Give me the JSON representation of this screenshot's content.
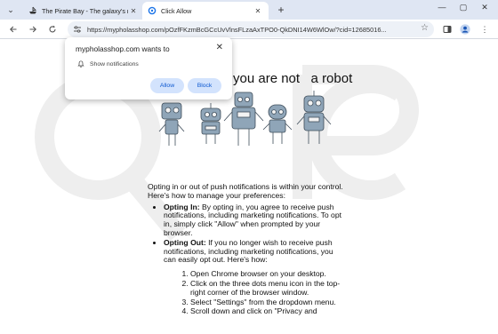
{
  "tabs": [
    {
      "title": "The Pirate Bay - The galaxy's m",
      "active": false
    },
    {
      "title": "Click Allow",
      "active": true
    }
  ],
  "toolbar": {
    "url": "https://mypholasshop.com/pOzfFKzmBcGCcUvVlnsFLzaAxTPO0-QkDNI14W6WlOw/?cid=12685016..."
  },
  "popup": {
    "title": "mypholasshop.com wants to",
    "permission": "Show notifications",
    "allow_label": "Allow",
    "block_label": "Block"
  },
  "page": {
    "heading": "you are not   a robot",
    "intro": "Opting in or out of push notifications is within your control. Here's how to manage your preferences:",
    "opt_in_label": "Opting In:",
    "opt_in_text": " By opting in, you agree to receive push notifications, including marketing notifications. To opt in, simply click \"Allow\" when prompted by your browser.",
    "opt_out_label": "Opting Out:",
    "opt_out_text": " If you no longer wish to receive push notifications, including marketing notifications, you can easily opt out. Here's how:",
    "steps": [
      "Open Chrome browser on your desktop.",
      "Click on the three dots menu icon in the top-right corner of the browser window.",
      "Select \"Settings\" from the dropdown menu.",
      "Scroll down and click on \"Privacy and"
    ]
  },
  "colors": {
    "tabbar": "#dfe6f3",
    "accent_button_bg": "#d3e3fd",
    "accent_button_text": "#0b57d0",
    "robot": "#8fa5b8"
  },
  "icons": [
    "tab-dropdown-icon",
    "pirate-ship-favicon",
    "click-allow-favicon",
    "close-icon",
    "new-tab-icon",
    "back-arrow-icon",
    "forward-arrow-icon",
    "reload-icon",
    "site-settings-icon",
    "star-icon",
    "sidebar-icon",
    "profile-icon",
    "menu-dots-icon",
    "bell-icon"
  ]
}
